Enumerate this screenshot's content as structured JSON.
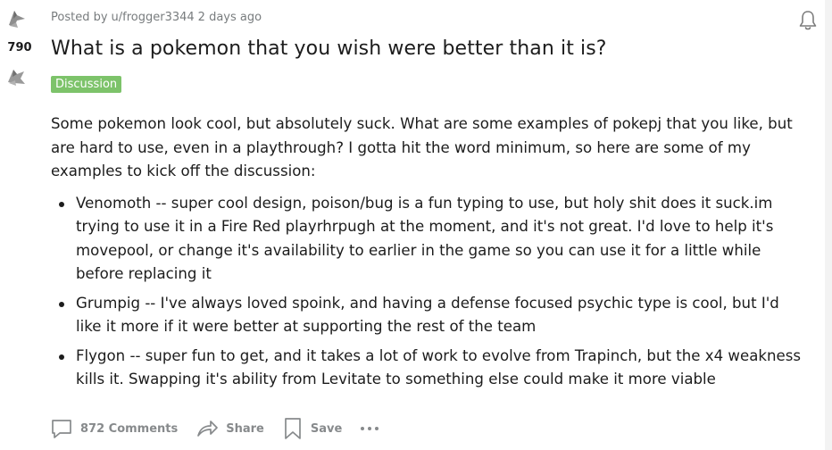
{
  "vote": {
    "count": "790"
  },
  "post": {
    "meta_prefix": "Posted by",
    "author": "u/frogger3344",
    "age": "2 days ago",
    "title": "What is a pokemon that you wish were better than it is?",
    "flair": "Discussion",
    "intro": "Some pokemon look cool, but absolutely suck. What are some examples of pokepj that you like, but are hard to use, even in a playthrough? I gotta hit the word minimum, so here are some of my examples to kick off the discussion:",
    "bullets": [
      "Venomoth -- super cool design, poison/bug is a fun typing to use, but holy shit does it suck.im trying to use it in a Fire Red playrhrpugh at the moment, and it's not great. I'd love to help it's movepool, or change it's availability to earlier in the game so you can use it for a little while before replacing it",
      "Grumpig -- I've always loved spoink, and having a defense focused psychic type is cool, but I'd like it more if it were better at supporting the rest of the team",
      "Flygon -- super fun to get, and it takes a lot of work to evolve from Trapinch, but the x4 weakness kills it. Swapping it's ability from Levitate to something else could make it more viable"
    ]
  },
  "actions": {
    "comments": "872 Comments",
    "share": "Share",
    "save": "Save"
  },
  "icons": {
    "upvote": "upvote-arrow-icon",
    "downvote": "downvote-arrow-icon",
    "bell": "bell-icon",
    "comment": "comment-bubble-icon",
    "share": "share-arrow-icon",
    "save": "bookmark-icon",
    "more": "more-options-icon"
  },
  "colors": {
    "flair_bg": "#7dc36a",
    "meta_text": "#787c7e",
    "action_text": "#878a8c"
  }
}
